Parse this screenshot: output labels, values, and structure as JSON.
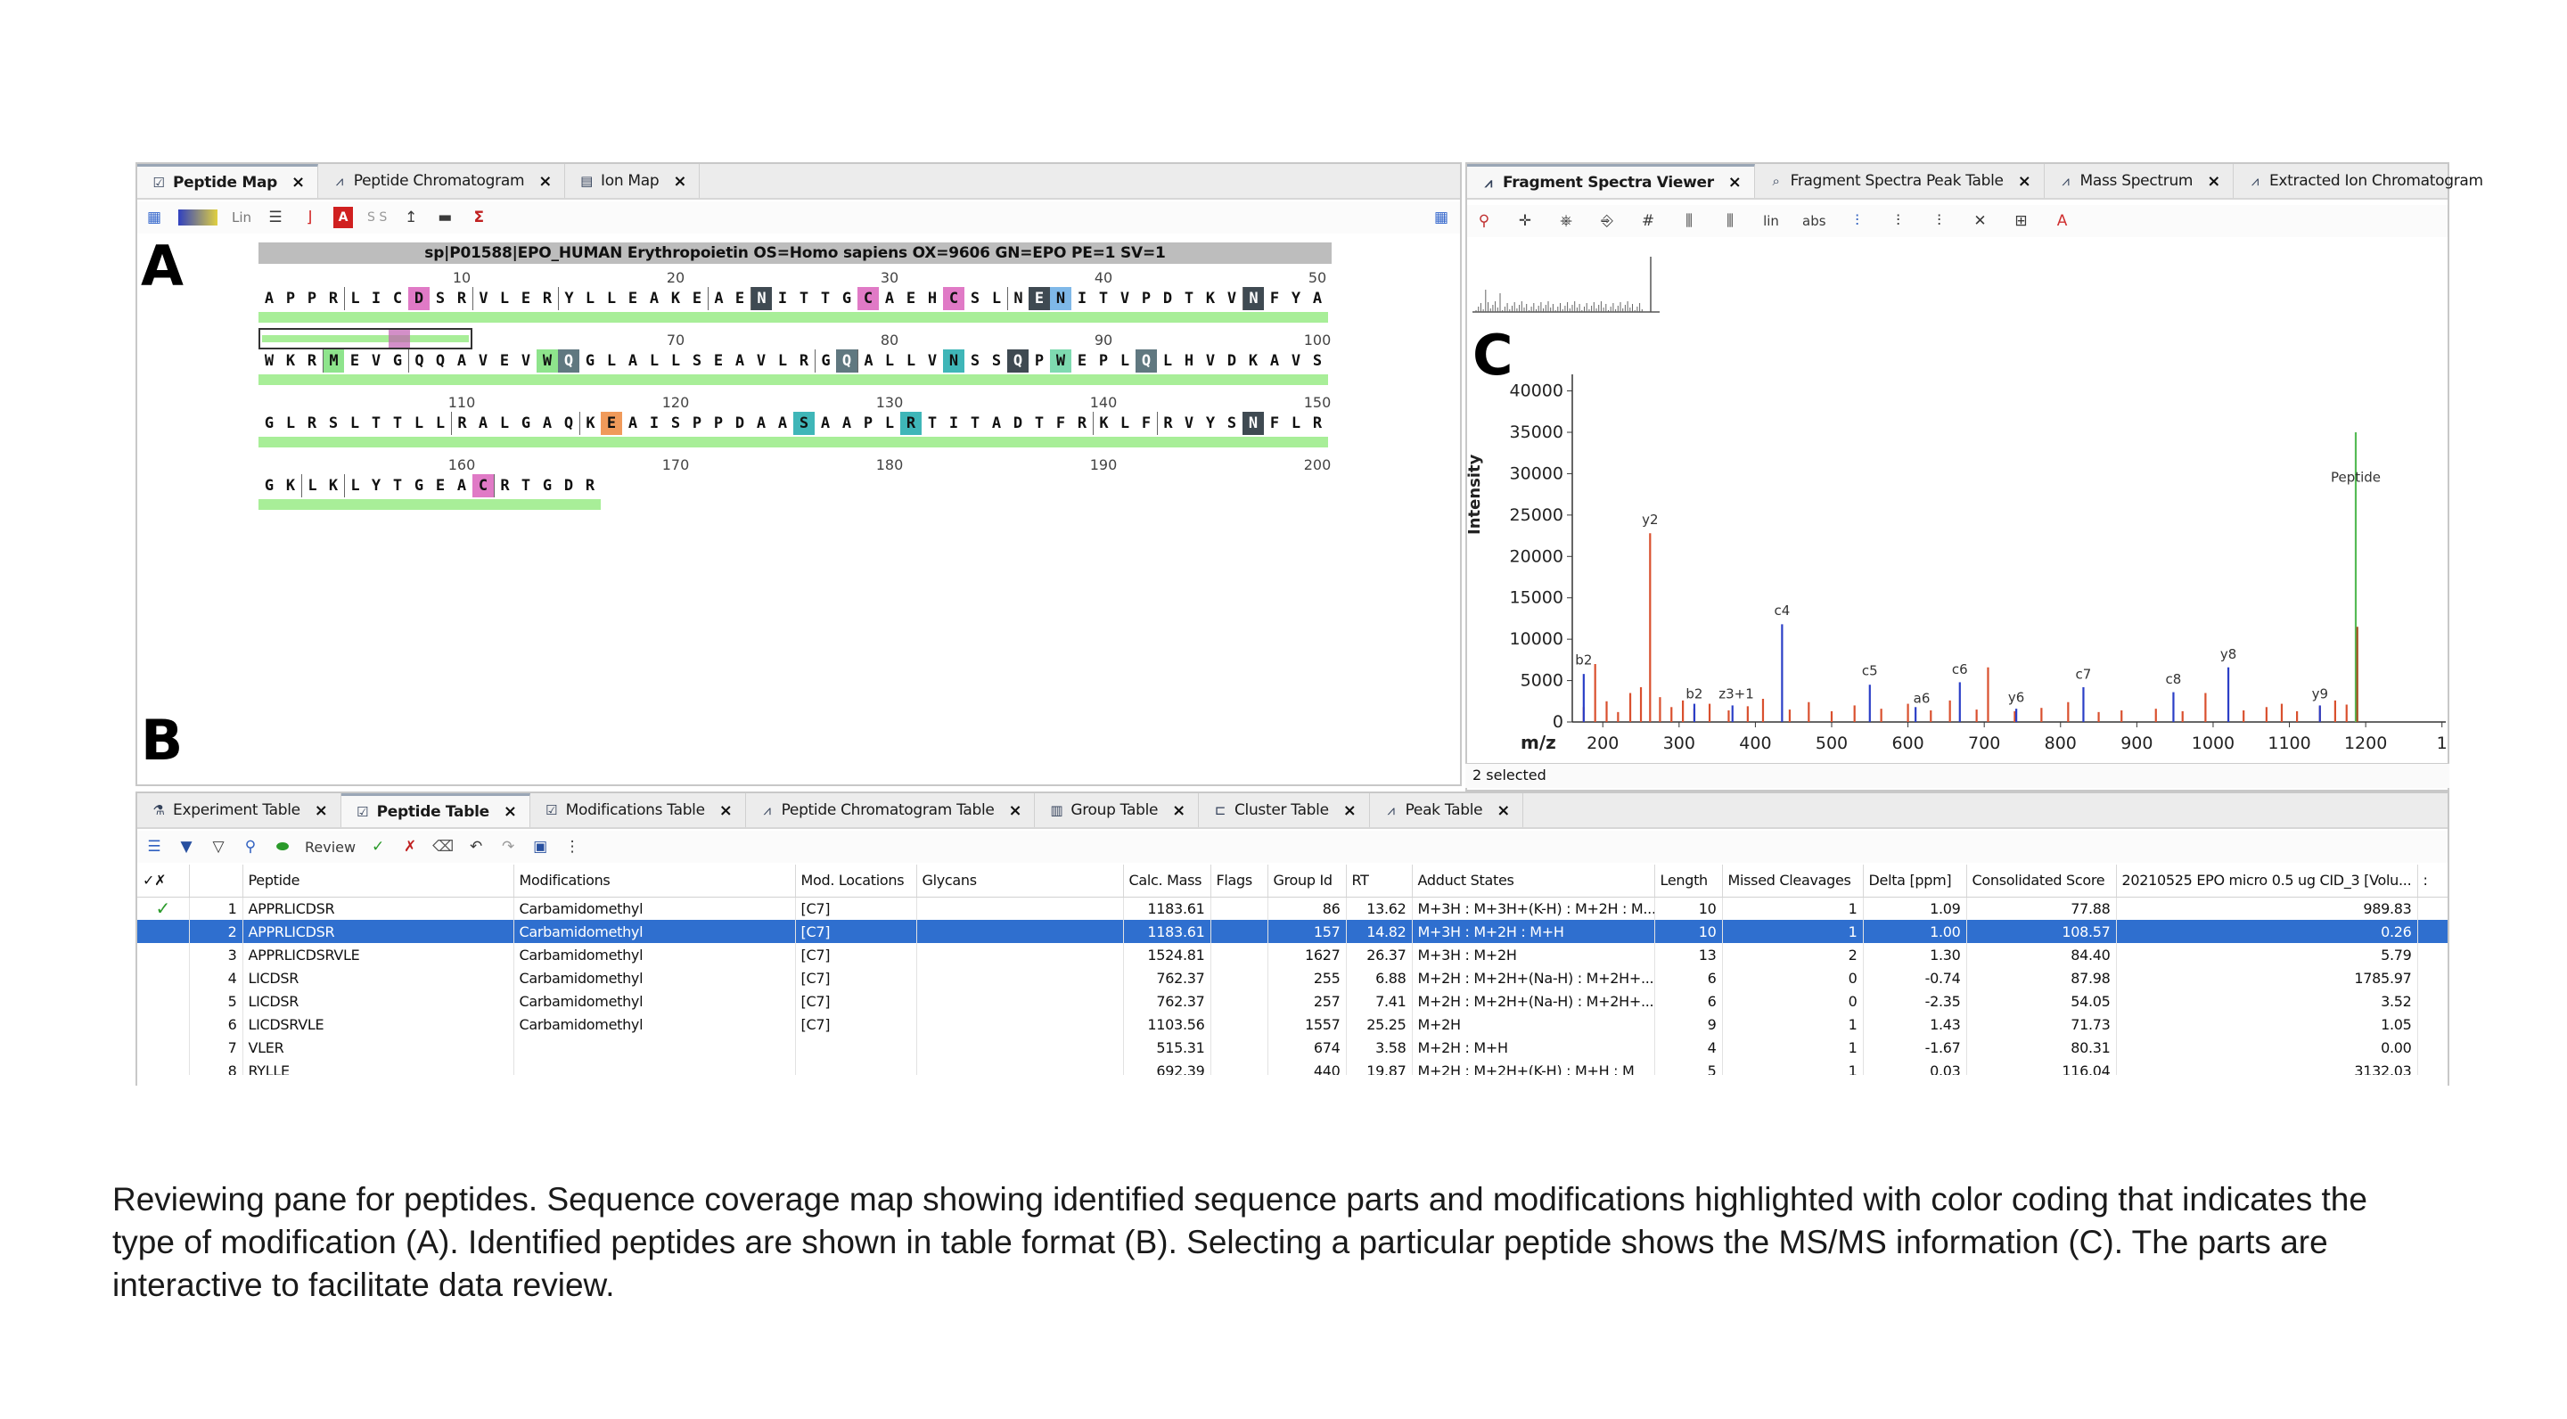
{
  "letters": {
    "a": "A",
    "b": "B",
    "c": "C"
  },
  "left_tabs": [
    {
      "label": "Peptide Map",
      "icon": "peptide-map-icon"
    },
    {
      "label": "Peptide Chromatogram",
      "icon": "chromatogram-icon"
    },
    {
      "label": "Ion Map",
      "icon": "ion-map-icon"
    }
  ],
  "left_toolbar": {
    "lin": "Lin",
    "ss": "S S"
  },
  "sequence_header": "sp|P01588|EPO_HUMAN Erythropoietin OS=Homo sapiens OX=9606 GN=EPO PE=1 SV=1",
  "sequence_rows": [
    {
      "ticks": [
        "10",
        "20",
        "30",
        "40",
        "50"
      ],
      "residues": "APPRLICDSRVLERYLLEAKEAENITTGCAEHCSLNENITVPDTKVNFYA"
    },
    {
      "ticks": [
        "60",
        "70",
        "80",
        "90",
        "100"
      ],
      "residues": "WKRMEVGQQAVEVWQGLALLSEAVLRGQALLVNSSQPWEPLQLHVDKAVS"
    },
    {
      "ticks": [
        "110",
        "120",
        "130",
        "140",
        "150"
      ],
      "residues": "GLRSLTTLLRALGAQKEAISPPDAASAAPLRTITADTFRKLFRVYSNFLR"
    },
    {
      "ticks": [
        "160",
        "170",
        "180",
        "190",
        "200"
      ],
      "residues": "GKLKLYTGEACRTGDR"
    }
  ],
  "right_tabs": [
    {
      "label": "Fragment Spectra Viewer",
      "icon": "spectra-viewer-icon"
    },
    {
      "label": "Fragment Spectra Peak Table",
      "icon": "peak-table-icon"
    },
    {
      "label": "Mass Spectrum",
      "icon": "mass-spectrum-icon"
    },
    {
      "label": "Extracted Ion Chromatogram",
      "icon": "xic-icon"
    }
  ],
  "right_toolbar": {
    "lin": "lin",
    "abs": "abs"
  },
  "spectrum": {
    "ylabel": "Intensity",
    "xlabel": "m/z",
    "status": "2 selected"
  },
  "chart_data": {
    "type": "bar",
    "xlabel": "m/z",
    "ylabel": "Intensity",
    "xlim": [
      160,
      1305
    ],
    "ylim": [
      0,
      42000
    ],
    "xticks": [
      "200",
      "300",
      "400",
      "500",
      "600",
      "700",
      "800",
      "900",
      "1000",
      "1100",
      "1200",
      "1"
    ],
    "yticks": [
      "0",
      "5000",
      "10000",
      "15000",
      "20000",
      "25000",
      "30000",
      "35000",
      "40000"
    ],
    "series": [
      {
        "color": "#d9502e",
        "x": [
          175,
          190,
          205,
          220,
          236,
          250,
          262,
          275,
          290,
          305,
          320,
          340,
          365,
          390,
          410,
          445,
          470,
          500,
          530,
          565,
          600,
          630,
          655,
          690,
          705,
          740,
          775,
          810,
          850,
          880,
          925,
          960,
          990,
          1040,
          1070,
          1090,
          1110,
          1140,
          1160,
          1175
        ],
        "values": [
          1800,
          7000,
          2500,
          1200,
          3500,
          4200,
          22800,
          3000,
          1800,
          2600,
          1600,
          2200,
          1400,
          1900,
          2800,
          1500,
          2400,
          1300,
          2000,
          1600,
          2200,
          1400,
          2600,
          1500,
          6600,
          1300,
          1700,
          2400,
          1200,
          1400,
          1600,
          1300,
          3500,
          1400,
          1800,
          2200,
          1300,
          1900,
          2600,
          2100
        ]
      },
      {
        "color": "#2b3fc7",
        "x": [
          175,
          320,
          370,
          435,
          550,
          610,
          668,
          742,
          830,
          948,
          1020,
          1140
        ],
        "values": [
          5800,
          2200,
          2000,
          11800,
          4500,
          1800,
          4800,
          1600,
          4200,
          3600,
          6600,
          2000
        ]
      },
      {
        "color": "#55bb55",
        "x": [
          1187
        ],
        "values": [
          35000
        ]
      },
      {
        "color": "#a05020",
        "x": [
          1189
        ],
        "values": [
          11500
        ]
      }
    ],
    "annotations": [
      {
        "text": "b2",
        "x": 175,
        "y": 6500
      },
      {
        "text": "y2",
        "x": 262,
        "y": 23500
      },
      {
        "text": "b2",
        "x": 320,
        "y": 2400
      },
      {
        "text": "z3+1",
        "x": 375,
        "y": 2400
      },
      {
        "text": "c4",
        "x": 435,
        "y": 12500
      },
      {
        "text": "c5",
        "x": 550,
        "y": 5200
      },
      {
        "text": "a6",
        "x": 618,
        "y": 1900
      },
      {
        "text": "c6",
        "x": 668,
        "y": 5400
      },
      {
        "text": "y6",
        "x": 742,
        "y": 2000
      },
      {
        "text": "c7",
        "x": 830,
        "y": 4800
      },
      {
        "text": "c8",
        "x": 948,
        "y": 4200
      },
      {
        "text": "y8",
        "x": 1020,
        "y": 7200
      },
      {
        "text": "y9",
        "x": 1140,
        "y": 2400
      },
      {
        "text": "Peptide",
        "x": 1187,
        "y": 28600
      }
    ]
  },
  "bottom_tabs": [
    {
      "label": "Experiment Table",
      "icon": "experiment-table-icon"
    },
    {
      "label": "Peptide Table",
      "icon": "peptide-table-icon"
    },
    {
      "label": "Modifications Table",
      "icon": "modifications-table-icon"
    },
    {
      "label": "Peptide Chromatogram Table",
      "icon": "chromatogram-table-icon"
    },
    {
      "label": "Group Table",
      "icon": "group-table-icon"
    },
    {
      "label": "Cluster Table",
      "icon": "cluster-table-icon"
    },
    {
      "label": "Peak Table",
      "icon": "peak-table-icon"
    }
  ],
  "bottom_toolbar": {
    "review": "Review"
  },
  "table": {
    "columns": [
      "✓✗",
      "",
      "Peptide",
      "Modifications",
      "Mod. Locations",
      "Glycans",
      "Calc. Mass",
      "Flags",
      "Group Id",
      "RT",
      "Adduct States",
      "Length",
      "Missed Cleavages",
      "Delta [ppm]",
      "Consolidated Score",
      "20210525 EPO micro 0.5 ug CID_3 [Volu...",
      ":"
    ],
    "rows": [
      {
        "check": "✓",
        "idx": "1",
        "peptide": "APPRLICDSR",
        "mod": "Carbamidomethyl",
        "loc": "[C7]",
        "gly": "",
        "mass": "1183.61",
        "flags": "",
        "group": "86",
        "rt": "13.62",
        "adduct": "M+3H : M+3H+(K-H) : M+2H : M...",
        "len": "10",
        "missed": "1",
        "delta": "1.09",
        "score": "77.88",
        "vol": "989.83"
      },
      {
        "check": "",
        "idx": "2",
        "peptide": "APPRLICDSR",
        "mod": "Carbamidomethyl",
        "loc": "[C7]",
        "gly": "",
        "mass": "1183.61",
        "flags": "",
        "group": "157",
        "rt": "14.82",
        "adduct": "M+3H : M+2H : M+H",
        "len": "10",
        "missed": "1",
        "delta": "1.00",
        "score": "108.57",
        "vol": "0.26"
      },
      {
        "check": "",
        "idx": "3",
        "peptide": "APPRLICDSRVLE",
        "mod": "Carbamidomethyl",
        "loc": "[C7]",
        "gly": "",
        "mass": "1524.81",
        "flags": "",
        "group": "1627",
        "rt": "26.37",
        "adduct": "M+3H : M+2H",
        "len": "13",
        "missed": "2",
        "delta": "1.30",
        "score": "84.40",
        "vol": "5.79"
      },
      {
        "check": "",
        "idx": "4",
        "peptide": "LICDSR",
        "mod": "Carbamidomethyl",
        "loc": "[C7]",
        "gly": "",
        "mass": "762.37",
        "flags": "",
        "group": "255",
        "rt": "6.88",
        "adduct": "M+2H : M+2H+(Na-H) : M+2H+...",
        "len": "6",
        "missed": "0",
        "delta": "-0.74",
        "score": "87.98",
        "vol": "1785.97"
      },
      {
        "check": "",
        "idx": "5",
        "peptide": "LICDSR",
        "mod": "Carbamidomethyl",
        "loc": "[C7]",
        "gly": "",
        "mass": "762.37",
        "flags": "",
        "group": "257",
        "rt": "7.41",
        "adduct": "M+2H : M+2H+(Na-H) : M+2H+...",
        "len": "6",
        "missed": "0",
        "delta": "-2.35",
        "score": "54.05",
        "vol": "3.52"
      },
      {
        "check": "",
        "idx": "6",
        "peptide": "LICDSRVLE",
        "mod": "Carbamidomethyl",
        "loc": "[C7]",
        "gly": "",
        "mass": "1103.56",
        "flags": "",
        "group": "1557",
        "rt": "25.25",
        "adduct": "M+2H",
        "len": "9",
        "missed": "1",
        "delta": "1.43",
        "score": "71.73",
        "vol": "1.05"
      },
      {
        "check": "",
        "idx": "7",
        "peptide": "VLER",
        "mod": "",
        "loc": "",
        "gly": "",
        "mass": "515.31",
        "flags": "",
        "group": "674",
        "rt": "3.58",
        "adduct": "M+2H : M+H",
        "len": "4",
        "missed": "1",
        "delta": "-1.67",
        "score": "80.31",
        "vol": "0.00"
      },
      {
        "check": "",
        "idx": "8",
        "peptide": "RYLLE",
        "mod": "",
        "loc": "",
        "gly": "",
        "mass": "692.39",
        "flags": "",
        "group": "440",
        "rt": "19.87",
        "adduct": "M+2H : M+2H+(K-H) : M+H : M",
        "len": "5",
        "missed": "1",
        "delta": "0.03",
        "score": "116.04",
        "vol": "3132.03"
      }
    ]
  },
  "caption": "Reviewing pane for peptides. Sequence coverage map showing identified sequence parts and modifications highlighted with color coding that indicates the type of modification (A). Identified peptides are shown in table format (B). Selecting a particular peptide shows the MS/MS information (C). The parts are interactive to facilitate data review."
}
